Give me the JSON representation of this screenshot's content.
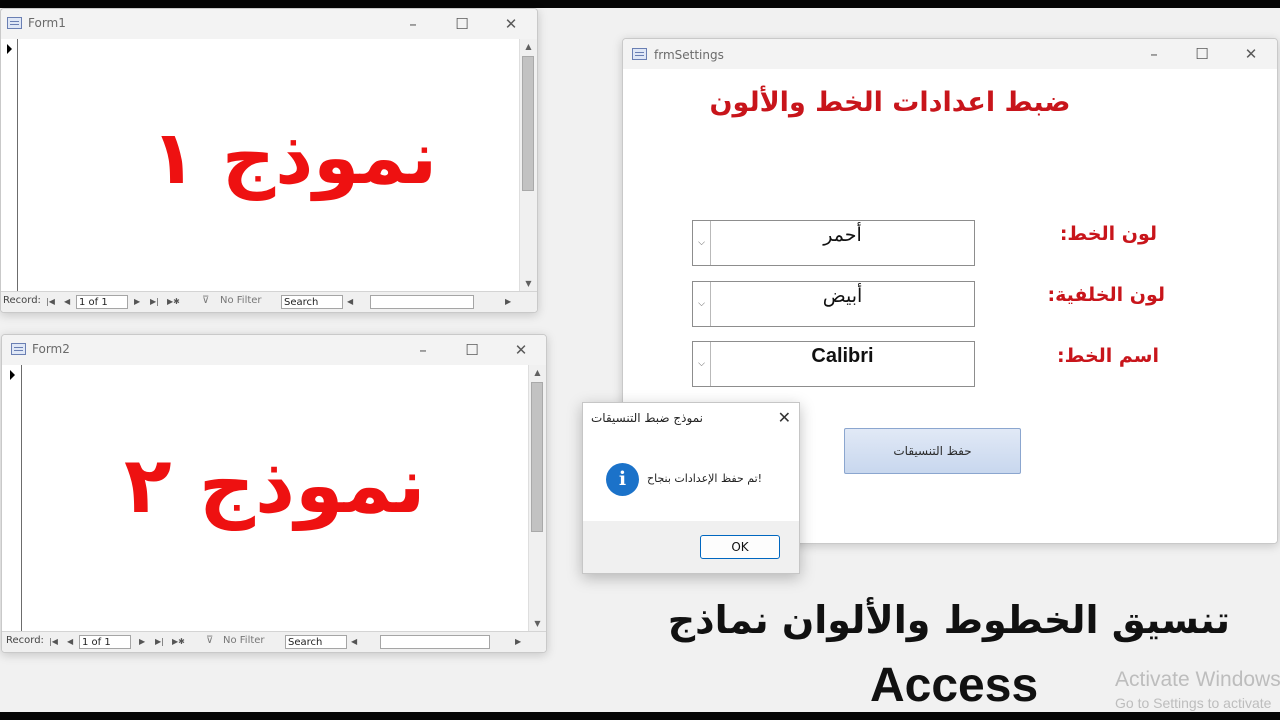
{
  "form1": {
    "title": "Form1",
    "label": "نموذج ١",
    "nav": {
      "record_label": "Record:",
      "record_value": "1 of 1",
      "filter_label": "No Filter",
      "search_label": "Search"
    }
  },
  "form2": {
    "title": "Form2",
    "label": "نموذج ٢",
    "nav": {
      "record_label": "Record:",
      "record_value": "1 of 1",
      "filter_label": "No Filter",
      "search_label": "Search"
    }
  },
  "settings": {
    "title": "frmSettings",
    "heading": "ضبط اعدادات الخط والألون",
    "fields": [
      {
        "label": "لون الخط:",
        "value": "أحمر"
      },
      {
        "label": "لون الخلفية:",
        "value": "أبيض"
      },
      {
        "label": "اسم الخط:",
        "value": "Calibri"
      }
    ],
    "save_button": "حفظ التنسيقات"
  },
  "message_box": {
    "title": "نموذج ضبط التنسيقات",
    "text": "!تم حفظ الإعدادات بنجاح",
    "ok_label": "OK",
    "icon": "info-icon"
  },
  "caption": {
    "line1": "تنسيق الخطوط والألوان نماذج",
    "line2": "Access"
  },
  "watermark": {
    "line1": "Activate Windows",
    "line2": "Go to Settings to activate"
  },
  "colors": {
    "label_red": "#c8151b",
    "big_red": "#ee1111",
    "info_blue": "#1b72c9"
  }
}
